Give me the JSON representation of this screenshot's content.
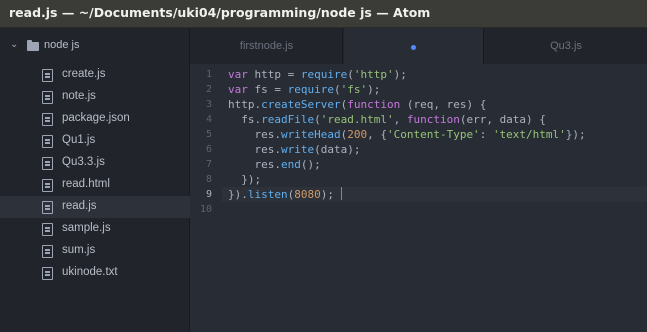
{
  "window": {
    "title": "read.js — ~/Documents/uki04/programming/node js — Atom"
  },
  "tree": {
    "root_label": "node js",
    "root_icon": "folder-icon",
    "expand_icon": "chevron-down-icon",
    "files": [
      {
        "name": "create.js",
        "selected": false
      },
      {
        "name": "note.js",
        "selected": false
      },
      {
        "name": "package.json",
        "selected": false
      },
      {
        "name": "Qu1.js",
        "selected": false
      },
      {
        "name": "Qu3.3.js",
        "selected": false
      },
      {
        "name": "read.html",
        "selected": false
      },
      {
        "name": "read.js",
        "selected": true
      },
      {
        "name": "sample.js",
        "selected": false
      },
      {
        "name": "sum.js",
        "selected": false
      },
      {
        "name": "ukinode.txt",
        "selected": false
      }
    ]
  },
  "tabs": [
    {
      "label": "firstnode.js",
      "active": false
    },
    {
      "label": "",
      "active": true,
      "modified": true
    },
    {
      "label": "Qu3.js",
      "active": false
    }
  ],
  "editor": {
    "current_line": 9,
    "lines": [
      [
        [
          "kw",
          "var"
        ],
        [
          "plain",
          " http = "
        ],
        [
          "fn",
          "require"
        ],
        [
          "plain",
          "("
        ],
        [
          "str",
          "'http'"
        ],
        [
          "plain",
          ");"
        ]
      ],
      [
        [
          "kw",
          "var"
        ],
        [
          "plain",
          " fs = "
        ],
        [
          "fn",
          "require"
        ],
        [
          "plain",
          "("
        ],
        [
          "str",
          "'fs'"
        ],
        [
          "plain",
          ");"
        ]
      ],
      [
        [
          "plain",
          "http."
        ],
        [
          "fn",
          "createServer"
        ],
        [
          "plain",
          "("
        ],
        [
          "kw",
          "function"
        ],
        [
          "plain",
          " (req, res) {"
        ]
      ],
      [
        [
          "plain",
          "  fs."
        ],
        [
          "fn",
          "readFile"
        ],
        [
          "plain",
          "("
        ],
        [
          "str",
          "'read.html'"
        ],
        [
          "plain",
          ", "
        ],
        [
          "kw",
          "function"
        ],
        [
          "plain",
          "(err, data) {"
        ]
      ],
      [
        [
          "plain",
          "    res."
        ],
        [
          "fn",
          "writeHead"
        ],
        [
          "plain",
          "("
        ],
        [
          "num",
          "200"
        ],
        [
          "plain",
          ", {"
        ],
        [
          "str",
          "'Content-Type'"
        ],
        [
          "plain",
          ": "
        ],
        [
          "str",
          "'text/html'"
        ],
        [
          "plain",
          "});"
        ]
      ],
      [
        [
          "plain",
          "    res."
        ],
        [
          "fn",
          "write"
        ],
        [
          "plain",
          "(data);"
        ]
      ],
      [
        [
          "plain",
          "    res."
        ],
        [
          "fn",
          "end"
        ],
        [
          "plain",
          "();"
        ]
      ],
      [
        [
          "plain",
          "  });"
        ]
      ],
      [
        [
          "plain",
          "})."
        ],
        [
          "fn",
          "listen"
        ],
        [
          "plain",
          "("
        ],
        [
          "num",
          "8080"
        ],
        [
          "plain",
          ");"
        ]
      ],
      []
    ]
  },
  "colors": {
    "keyword": "#c678dd",
    "function": "#61afef",
    "string": "#98c379",
    "number": "#d19a66",
    "plain": "#abb2bf",
    "accent": "#528bff"
  }
}
